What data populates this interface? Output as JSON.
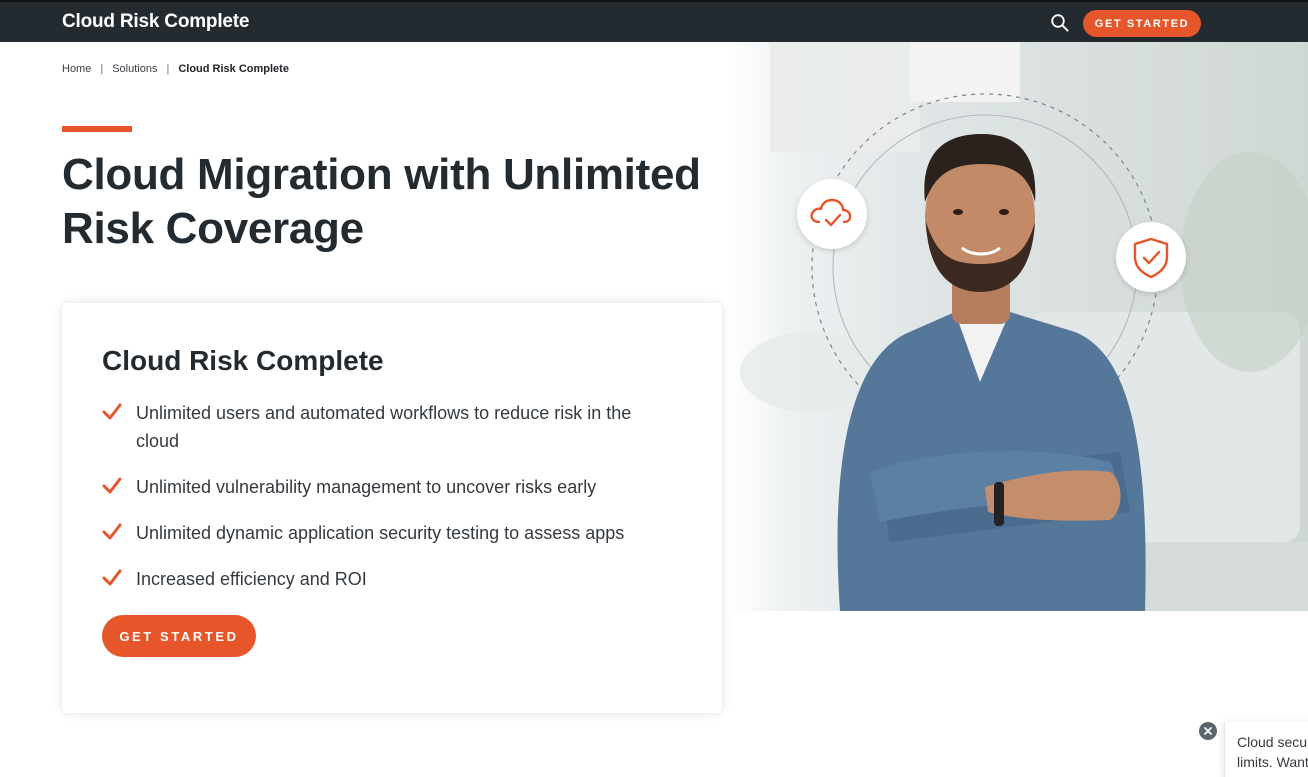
{
  "header": {
    "brand": "Cloud Risk Complete",
    "search_icon": "search-icon",
    "cta_label": "GET STARTED"
  },
  "breadcrumb": {
    "items": [
      "Home",
      "Solutions",
      "Cloud Risk Complete"
    ],
    "separator": "|"
  },
  "hero": {
    "title_line1": "Cloud Migration with Unlimited",
    "title_line2": "Risk Coverage",
    "photo_icons": [
      "cloud-check-icon",
      "shield-check-icon"
    ]
  },
  "card": {
    "title": "Cloud Risk Complete",
    "features": [
      "Unlimited users and automated workflows to reduce risk in the cloud",
      "Unlimited vulnerability management to uncover risks early",
      "Unlimited dynamic application security testing to assess apps",
      "Increased efficiency and ROI"
    ],
    "cta_label": "GET STARTED"
  },
  "toast": {
    "line1": "Cloud secur",
    "line2": "limits. Want"
  },
  "colors": {
    "accent": "#e6562a",
    "navbar": "#232a30",
    "heading": "#232a30"
  }
}
